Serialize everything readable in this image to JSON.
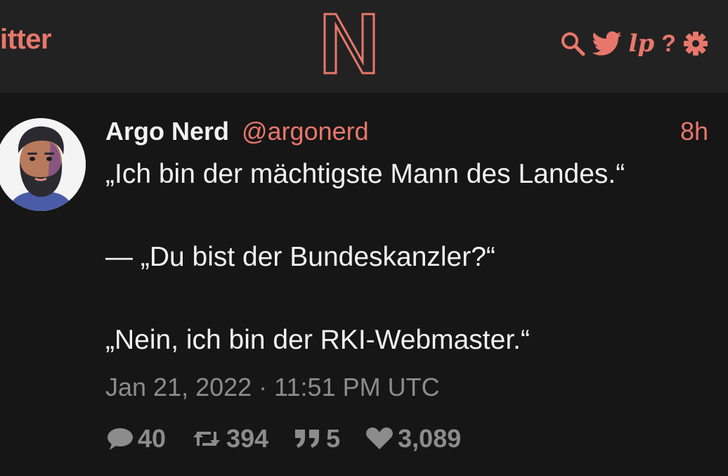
{
  "navbar": {
    "brand": "itter",
    "icons": [
      "search-icon",
      "twitter-bird-icon",
      "lp-icon",
      "help-icon",
      "settings-gear-icon"
    ],
    "lp_label": "lp",
    "help_label": "?"
  },
  "colors": {
    "accent": "#e8776b",
    "background": "#161616",
    "navbar": "#222222",
    "text": "#f2f2f2",
    "muted": "#8c8c8c"
  },
  "tweet": {
    "fullname": "Argo Nerd",
    "username": "@argonerd",
    "time": "8h",
    "lines": [
      "„Ich bin der mächtigste Mann des Landes.“",
      "— „Du bist der Bundeskanzler?“",
      "„Nein, ich bin der RKI-Webmaster.“"
    ],
    "date": "Jan 21, 2022 · 11:51 PM UTC",
    "stats": {
      "replies": "40",
      "retweets": "394",
      "quotes": "5",
      "likes": "3,089"
    }
  }
}
